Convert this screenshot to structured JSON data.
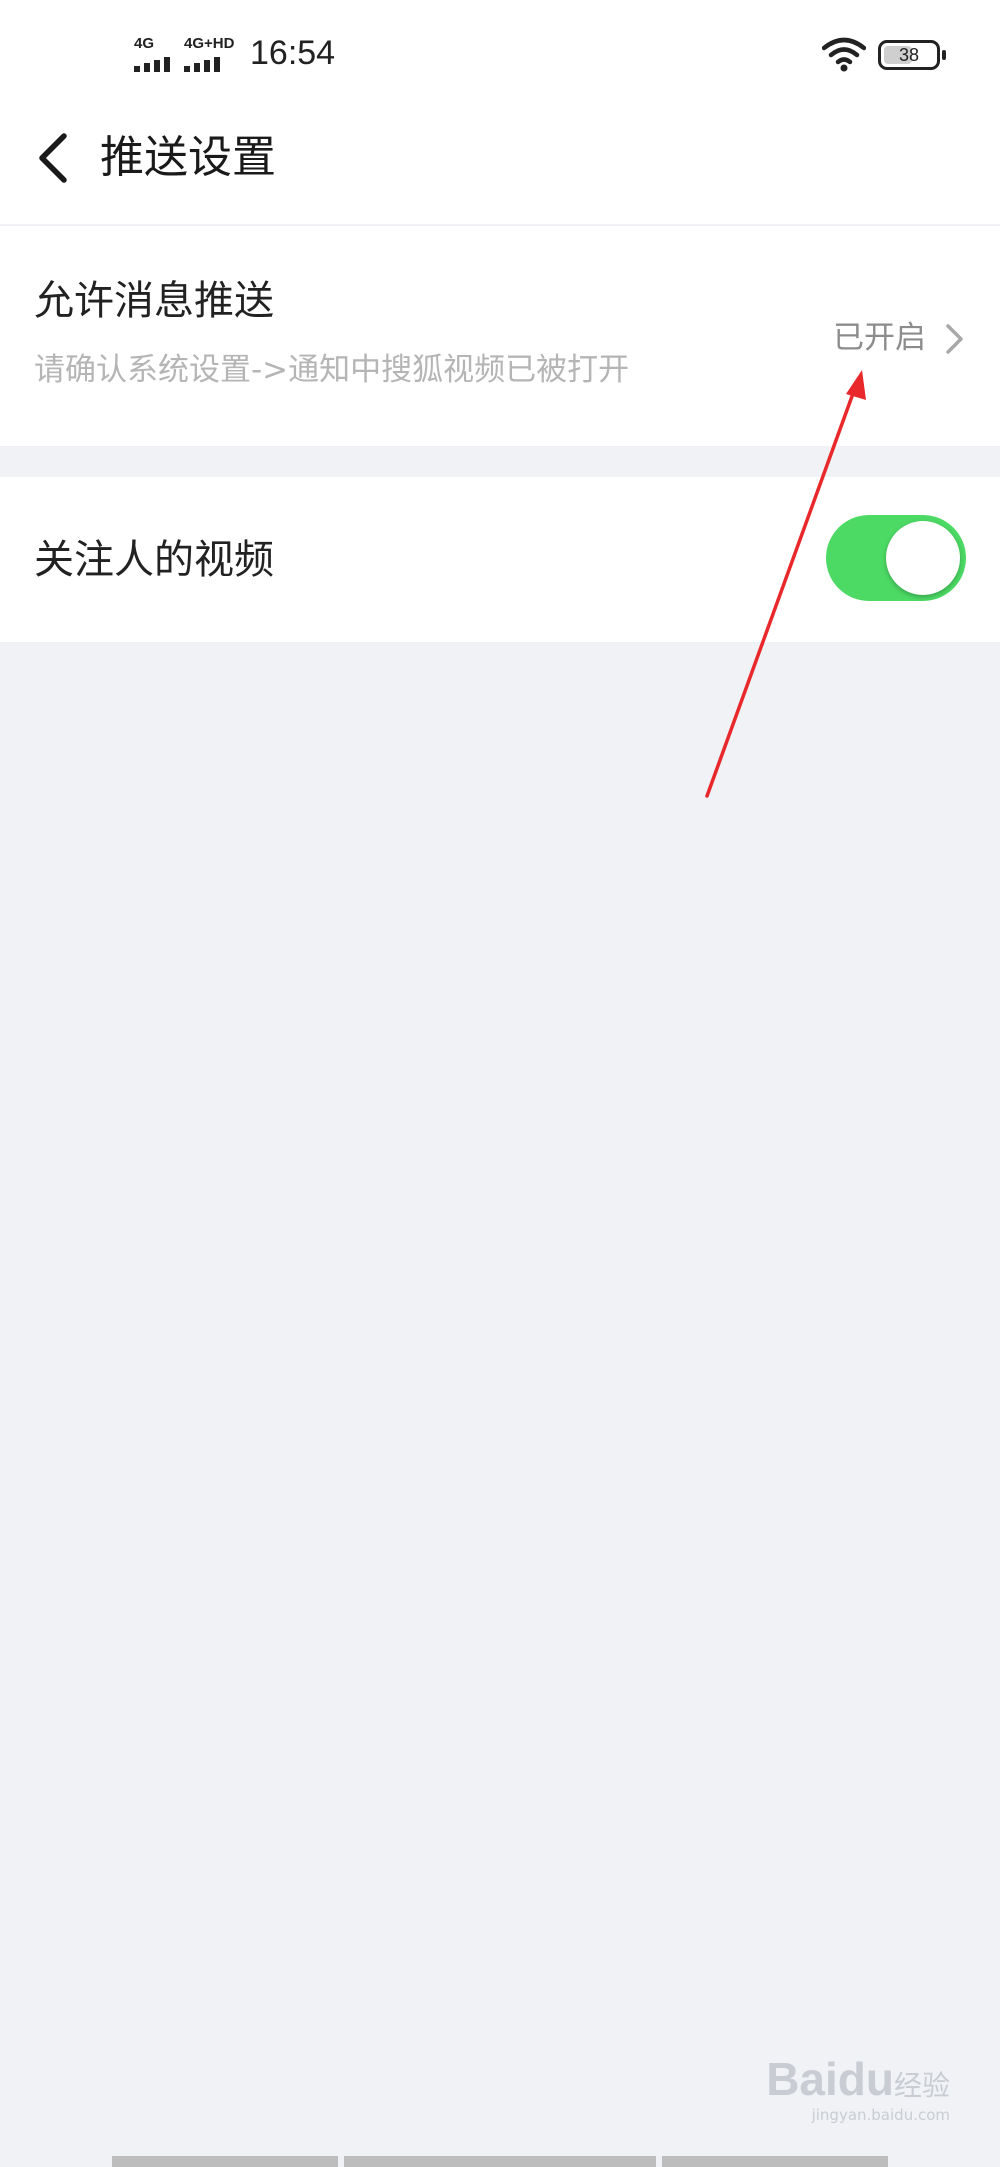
{
  "status_bar": {
    "network_1": "4G",
    "network_2": "4G+HD",
    "time": "16:54",
    "battery": "38"
  },
  "header": {
    "title": "推送设置"
  },
  "settings": {
    "allow_push": {
      "title": "允许消息推送",
      "subtitle": "请确认系统设置->通知中搜狐视频已被打开",
      "status": "已开启"
    },
    "follow_videos": {
      "title": "关注人的视频",
      "enabled": true
    }
  },
  "watermark": {
    "brand": "Baidu",
    "text": "经验",
    "url": "jingyan.baidu.com"
  },
  "colors": {
    "toggle_on": "#4cd964",
    "annotation_arrow": "#e8282b",
    "background": "#f0f2f5"
  }
}
